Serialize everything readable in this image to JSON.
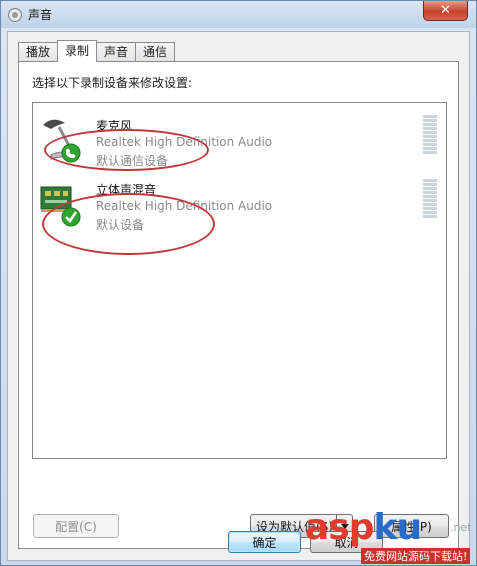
{
  "window": {
    "title": "声音",
    "close_symbol": "✕"
  },
  "tabs": [
    {
      "label": "播放",
      "active": false
    },
    {
      "label": "录制",
      "active": true
    },
    {
      "label": "声音",
      "active": false
    },
    {
      "label": "通信",
      "active": false
    }
  ],
  "instruction": "选择以下录制设备来修改设置:",
  "devices": [
    {
      "name": "麦克风",
      "driver": "Realtek High Definition Audio",
      "status": "默认通信设备",
      "icon": "microphone-icon",
      "badge": "phone-badge-icon"
    },
    {
      "name": "立体声混音",
      "driver": "Realtek High Definition Audio",
      "status": "默认设备",
      "icon": "sound-card-icon",
      "badge": "checkmark-badge-icon"
    }
  ],
  "buttons": {
    "configure": "配置(C)",
    "set_default": "设为默认值(S)",
    "properties": "属性(P)",
    "ok": "确定",
    "cancel": "取消"
  },
  "watermark": {
    "brand_a": "asp",
    "brand_b": "ku",
    "suffix": ".net",
    "tagline": "免费网站源码下载站!"
  },
  "colors": {
    "annotation": "#c0393a",
    "status_green": "#2fa52f"
  }
}
